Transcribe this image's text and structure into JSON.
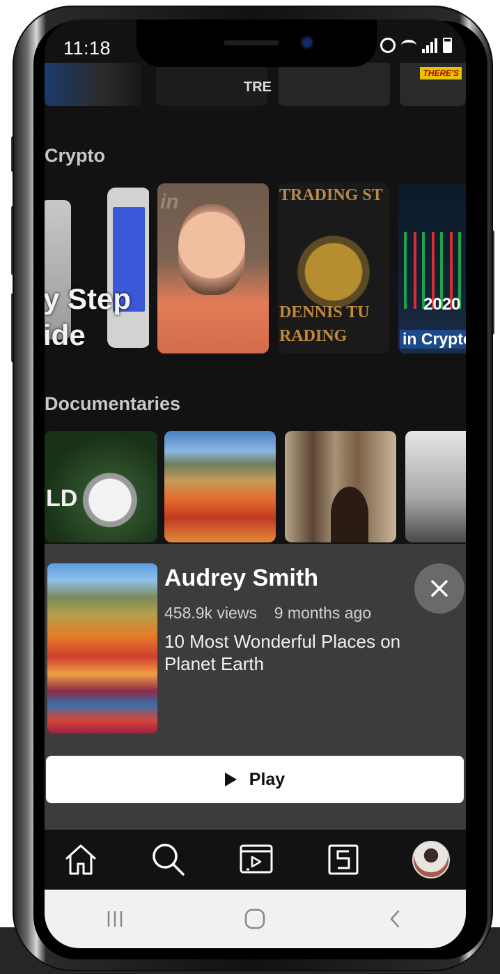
{
  "status_bar": {
    "time": "11:18"
  },
  "top_row": {
    "thumb_text": "TRE",
    "thumb_tag": "THERE'S"
  },
  "sections": [
    {
      "title": "Crypto",
      "thumbs": [
        {
          "text_line1": "y Step",
          "text_line2": "ide"
        },
        {
          "overlay": "in"
        },
        {
          "text_top": "TRADING ST",
          "text_bottom1": "DENNIS TU",
          "text_bottom2": "RADING"
        },
        {
          "text_year": "2020",
          "text_caption": "in Crypto"
        }
      ]
    },
    {
      "title": "Documentaries",
      "thumbs": [
        {
          "text": "LD"
        },
        {},
        {},
        {}
      ]
    }
  ],
  "player_card": {
    "name": "Audrey Smith",
    "views": "458.9k views",
    "age": "9 months ago",
    "title": "10 Most Wonderful Places on Planet Earth",
    "play_label": "Play"
  },
  "bottom_nav": [
    "home-icon",
    "search-icon",
    "video-library-icon",
    "shorts-icon",
    "avatar"
  ],
  "system_nav": [
    "recent-apps-icon",
    "home-circle-icon",
    "back-icon"
  ]
}
